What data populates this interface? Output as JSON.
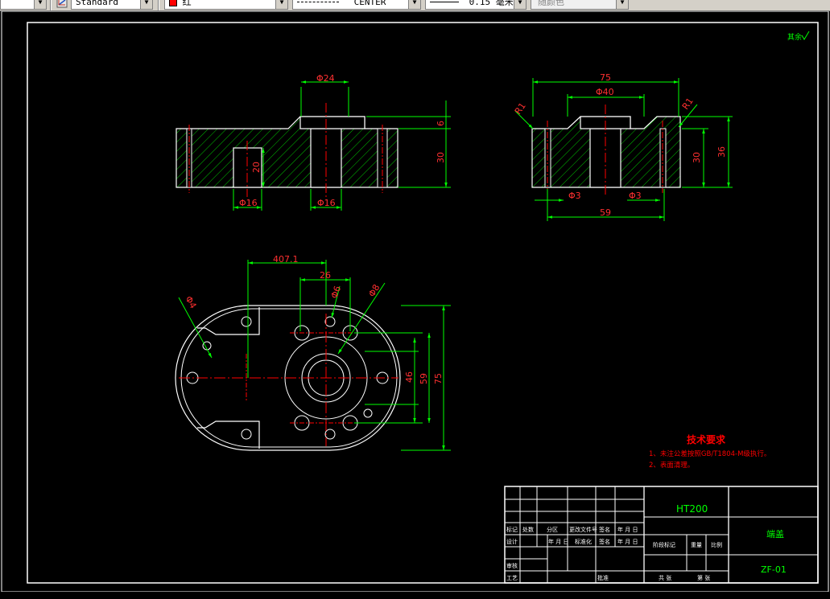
{
  "toolbar": {
    "dimstyle": "Standard",
    "color": "红",
    "linetype": "CENTER",
    "lineweight": "0.15 毫米",
    "plotstyle": "随颜色",
    "color_swatch": "#ff0000"
  },
  "drawing": {
    "roughness_note": "其余",
    "front_dims": {
      "d24": "Φ24",
      "d16a": "Φ16",
      "d16b": "Φ16",
      "h20": "20",
      "h6": "6",
      "h30": "30"
    },
    "side_dims": {
      "w75": "75",
      "d40": "Φ40",
      "r1a": "R1",
      "r1b": "R1",
      "d3a": "Φ3",
      "d3b": "Φ3",
      "w59": "59",
      "h30": "30",
      "h36": "36"
    },
    "top_dims": {
      "a407": "407.1",
      "w26": "26",
      "d6": "Φ6",
      "d8": "Φ8",
      "d4": "Φ4",
      "h46": "46",
      "h59": "59",
      "h75": "75"
    },
    "notes": {
      "title": "技术要求",
      "line1": "1、未注公差按照GB/T1804-M级执行。",
      "line2": "2、表面清理。"
    },
    "title_block": {
      "material": "HT200",
      "part_name": "端盖",
      "drawing_no": "ZF-01",
      "labels": {
        "mark": "标记",
        "count": "处数",
        "zone": "分区",
        "change_doc": "更改文件号",
        "sign": "签名",
        "ymd": "年 月 日",
        "design": "设计",
        "ymd2": "年 月 日",
        "standard": "标准化",
        "sign2": "签名",
        "ymd3": "年 月 日",
        "stage_mark": "阶段标记",
        "weight": "重量",
        "scale": "比例",
        "review": "审核",
        "process": "工艺",
        "approve": "批准",
        "total": "共  张",
        "sheet": "第  张"
      }
    }
  }
}
